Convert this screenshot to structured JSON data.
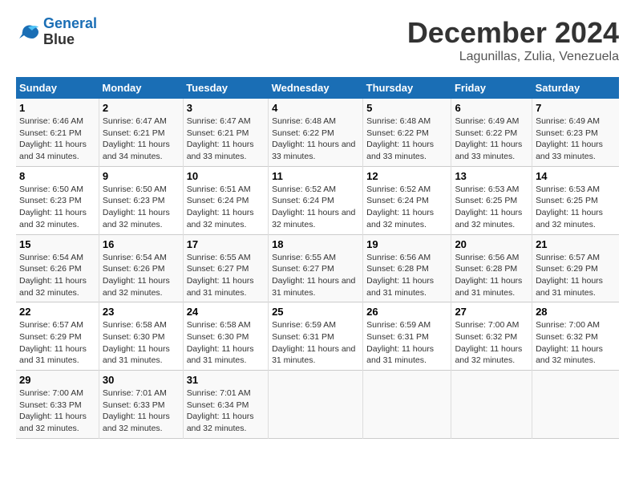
{
  "header": {
    "logo_line1": "General",
    "logo_line2": "Blue",
    "month": "December 2024",
    "location": "Lagunillas, Zulia, Venezuela"
  },
  "days_of_week": [
    "Sunday",
    "Monday",
    "Tuesday",
    "Wednesday",
    "Thursday",
    "Friday",
    "Saturday"
  ],
  "weeks": [
    [
      {
        "day": "1",
        "sunrise": "6:46 AM",
        "sunset": "6:21 PM",
        "daylight": "11 hours and 34 minutes."
      },
      {
        "day": "2",
        "sunrise": "6:47 AM",
        "sunset": "6:21 PM",
        "daylight": "11 hours and 34 minutes."
      },
      {
        "day": "3",
        "sunrise": "6:47 AM",
        "sunset": "6:21 PM",
        "daylight": "11 hours and 33 minutes."
      },
      {
        "day": "4",
        "sunrise": "6:48 AM",
        "sunset": "6:22 PM",
        "daylight": "11 hours and 33 minutes."
      },
      {
        "day": "5",
        "sunrise": "6:48 AM",
        "sunset": "6:22 PM",
        "daylight": "11 hours and 33 minutes."
      },
      {
        "day": "6",
        "sunrise": "6:49 AM",
        "sunset": "6:22 PM",
        "daylight": "11 hours and 33 minutes."
      },
      {
        "day": "7",
        "sunrise": "6:49 AM",
        "sunset": "6:23 PM",
        "daylight": "11 hours and 33 minutes."
      }
    ],
    [
      {
        "day": "8",
        "sunrise": "6:50 AM",
        "sunset": "6:23 PM",
        "daylight": "11 hours and 32 minutes."
      },
      {
        "day": "9",
        "sunrise": "6:50 AM",
        "sunset": "6:23 PM",
        "daylight": "11 hours and 32 minutes."
      },
      {
        "day": "10",
        "sunrise": "6:51 AM",
        "sunset": "6:24 PM",
        "daylight": "11 hours and 32 minutes."
      },
      {
        "day": "11",
        "sunrise": "6:52 AM",
        "sunset": "6:24 PM",
        "daylight": "11 hours and 32 minutes."
      },
      {
        "day": "12",
        "sunrise": "6:52 AM",
        "sunset": "6:24 PM",
        "daylight": "11 hours and 32 minutes."
      },
      {
        "day": "13",
        "sunrise": "6:53 AM",
        "sunset": "6:25 PM",
        "daylight": "11 hours and 32 minutes."
      },
      {
        "day": "14",
        "sunrise": "6:53 AM",
        "sunset": "6:25 PM",
        "daylight": "11 hours and 32 minutes."
      }
    ],
    [
      {
        "day": "15",
        "sunrise": "6:54 AM",
        "sunset": "6:26 PM",
        "daylight": "11 hours and 32 minutes."
      },
      {
        "day": "16",
        "sunrise": "6:54 AM",
        "sunset": "6:26 PM",
        "daylight": "11 hours and 32 minutes."
      },
      {
        "day": "17",
        "sunrise": "6:55 AM",
        "sunset": "6:27 PM",
        "daylight": "11 hours and 31 minutes."
      },
      {
        "day": "18",
        "sunrise": "6:55 AM",
        "sunset": "6:27 PM",
        "daylight": "11 hours and 31 minutes."
      },
      {
        "day": "19",
        "sunrise": "6:56 AM",
        "sunset": "6:28 PM",
        "daylight": "11 hours and 31 minutes."
      },
      {
        "day": "20",
        "sunrise": "6:56 AM",
        "sunset": "6:28 PM",
        "daylight": "11 hours and 31 minutes."
      },
      {
        "day": "21",
        "sunrise": "6:57 AM",
        "sunset": "6:29 PM",
        "daylight": "11 hours and 31 minutes."
      }
    ],
    [
      {
        "day": "22",
        "sunrise": "6:57 AM",
        "sunset": "6:29 PM",
        "daylight": "11 hours and 31 minutes."
      },
      {
        "day": "23",
        "sunrise": "6:58 AM",
        "sunset": "6:30 PM",
        "daylight": "11 hours and 31 minutes."
      },
      {
        "day": "24",
        "sunrise": "6:58 AM",
        "sunset": "6:30 PM",
        "daylight": "11 hours and 31 minutes."
      },
      {
        "day": "25",
        "sunrise": "6:59 AM",
        "sunset": "6:31 PM",
        "daylight": "11 hours and 31 minutes."
      },
      {
        "day": "26",
        "sunrise": "6:59 AM",
        "sunset": "6:31 PM",
        "daylight": "11 hours and 31 minutes."
      },
      {
        "day": "27",
        "sunrise": "7:00 AM",
        "sunset": "6:32 PM",
        "daylight": "11 hours and 32 minutes."
      },
      {
        "day": "28",
        "sunrise": "7:00 AM",
        "sunset": "6:32 PM",
        "daylight": "11 hours and 32 minutes."
      }
    ],
    [
      {
        "day": "29",
        "sunrise": "7:00 AM",
        "sunset": "6:33 PM",
        "daylight": "11 hours and 32 minutes."
      },
      {
        "day": "30",
        "sunrise": "7:01 AM",
        "sunset": "6:33 PM",
        "daylight": "11 hours and 32 minutes."
      },
      {
        "day": "31",
        "sunrise": "7:01 AM",
        "sunset": "6:34 PM",
        "daylight": "11 hours and 32 minutes."
      },
      {
        "day": "",
        "sunrise": "",
        "sunset": "",
        "daylight": ""
      },
      {
        "day": "",
        "sunrise": "",
        "sunset": "",
        "daylight": ""
      },
      {
        "day": "",
        "sunrise": "",
        "sunset": "",
        "daylight": ""
      },
      {
        "day": "",
        "sunrise": "",
        "sunset": "",
        "daylight": ""
      }
    ]
  ]
}
